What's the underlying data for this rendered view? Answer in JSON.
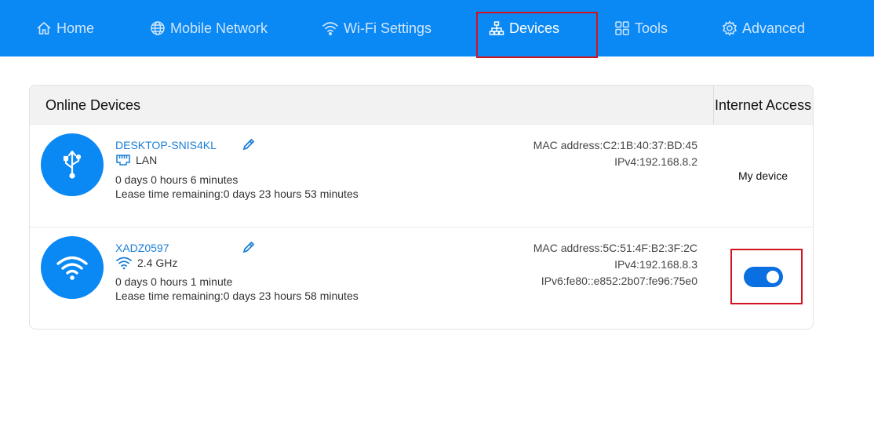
{
  "nav": {
    "home": "Home",
    "mobile_network": "Mobile Network",
    "wifi_settings": "Wi-Fi Settings",
    "devices": "Devices",
    "tools": "Tools",
    "advanced": "Advanced"
  },
  "table": {
    "header_online": "Online Devices",
    "header_access": "Internet Access"
  },
  "devices": [
    {
      "name": "DESKTOP-SNIS4KL",
      "connection": "LAN",
      "duration": "0 days 0 hours 6 minutes",
      "lease": "Lease time remaining:0 days 23 hours 53 minutes",
      "mac": "MAC address:C2:1B:40:37:BD:45",
      "ipv4": "IPv4:192.168.8.2",
      "access": "My device",
      "icon": "usb-icon"
    },
    {
      "name": "XADZ0597",
      "connection": "2.4 GHz",
      "duration": "0 days 0 hours 1 minute",
      "lease": "Lease time remaining:0 days 23 hours 58 minutes",
      "mac": "MAC address:5C:51:4F:B2:3F:2C",
      "ipv4": "IPv4:192.168.8.3",
      "ipv6": "IPv6:fe80::e852:2b07:fe96:75e0",
      "access_enabled": true,
      "icon": "wifi-icon"
    }
  ],
  "colors": {
    "nav_bg": "#0a88f4",
    "accent": "#0a88f4",
    "link": "#1a7fd6",
    "highlight": "#d0131f",
    "toggle_on": "#0a6fe0"
  }
}
